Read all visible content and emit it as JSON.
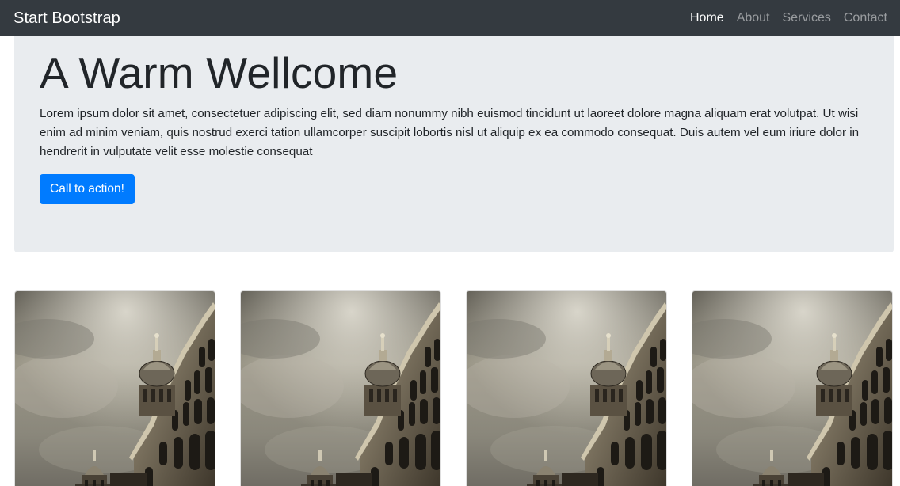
{
  "navbar": {
    "brand": "Start Bootstrap",
    "links": [
      {
        "label": "Home",
        "active": true
      },
      {
        "label": "About",
        "active": false
      },
      {
        "label": "Services",
        "active": false
      },
      {
        "label": "Contact",
        "active": false
      }
    ]
  },
  "hero": {
    "title": "A Warm Wellcome",
    "lead": "Lorem ipsum dolor sit amet, consectetuer adipiscing elit, sed diam nonummy nibh euismod tincidunt ut laoreet dolore magna aliquam erat volutpat. Ut wisi enim ad minim veniam, quis nostrud exerci tation ullamcorper suscipit lobortis nisl ut aliquip ex ea commodo consequat. Duis autem vel eum iriure dolor in hendrerit in vulputate velit esse molestie consequat",
    "cta_label": "Call to action!"
  },
  "cards": [
    {
      "image": "domed-building-photo"
    },
    {
      "image": "domed-building-photo"
    },
    {
      "image": "domed-building-photo"
    },
    {
      "image": "domed-building-photo"
    }
  ],
  "colors": {
    "navbar_bg": "#343a40",
    "jumbotron_bg": "#e9ecef",
    "primary": "#007bff"
  }
}
